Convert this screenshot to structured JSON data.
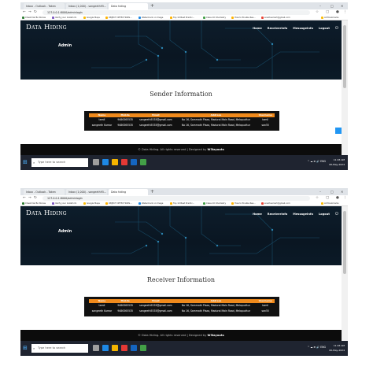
{
  "browser": {
    "tabs": [
      {
        "label": "Inbox - Outlook - Taken",
        "active": false
      },
      {
        "label": "Inbox (1,000) - sangeeth95...",
        "active": false
      },
      {
        "label": "Data hiding",
        "active": true
      }
    ],
    "url": "127.0.0.1:8000/adminlogin",
    "bookmarks": [
      "Cheat Del Bo Stores",
      "Verify your Instaform",
      "Google Maps",
      "OBJECT DETECTIONS...",
      "Watermark on Image",
      "Top 10 Best Practic...",
      "Class 10 Chemistry",
      "How to Enable Res...",
      "sravitusmart@gmail.com"
    ],
    "other_bookmarks": "All Bookmarks"
  },
  "site": {
    "brand": "Data Hiding",
    "nav": [
      "Home",
      "ReceiverInfo",
      "MessageInfo",
      "Logout"
    ],
    "hero_title": "Admin",
    "footer_text": "© Data Hiding. All rights reserved | Designed by ",
    "footer_author": "W3layouts"
  },
  "views": [
    {
      "section_title": "Sender Information",
      "columns": [
        "Name",
        "Mobile",
        "Email",
        "Address",
        "Username"
      ],
      "rows": [
        [
          "tamil",
          "9486365535",
          "sangeeth5535@gmail.com",
          "No 16, Sammath Plaza, Madurai Main Road, Melapudhur",
          "tamil"
        ],
        [
          "sangeeth Kumar",
          "9486365535",
          "sangeeth5535@gmail.com",
          "No 16, Sammath Plaza, Madurai Main Road, Melapudhur",
          "san55"
        ]
      ]
    },
    {
      "section_title": "Receiver Information",
      "columns": [
        "Name",
        "Mobile",
        "Email",
        "Address",
        "Username"
      ],
      "rows": [
        [
          "tamil",
          "9486365535",
          "sangeeth5535@gmail.com",
          "No 16, Sammath Plaza, Madurai Main Road, Melapudhur",
          "tamil"
        ],
        [
          "sangeeth Kumar",
          "9486365535",
          "sangeeth5535@gmail.com",
          "No 16, Sammath Plaza, Madurai Main Road, Melapudhur",
          "san55"
        ]
      ]
    }
  ],
  "taskbar": {
    "search_placeholder": "Type here to search",
    "tray_icons": "^ ☁ ⊕ 🔊 ENG",
    "time": "11:03 AM",
    "date": "06-May-2024"
  },
  "colors": {
    "table_header": "#f08a1c",
    "hero_bg": "#0d1d2b",
    "footer_bg": "#0c0c0c"
  }
}
